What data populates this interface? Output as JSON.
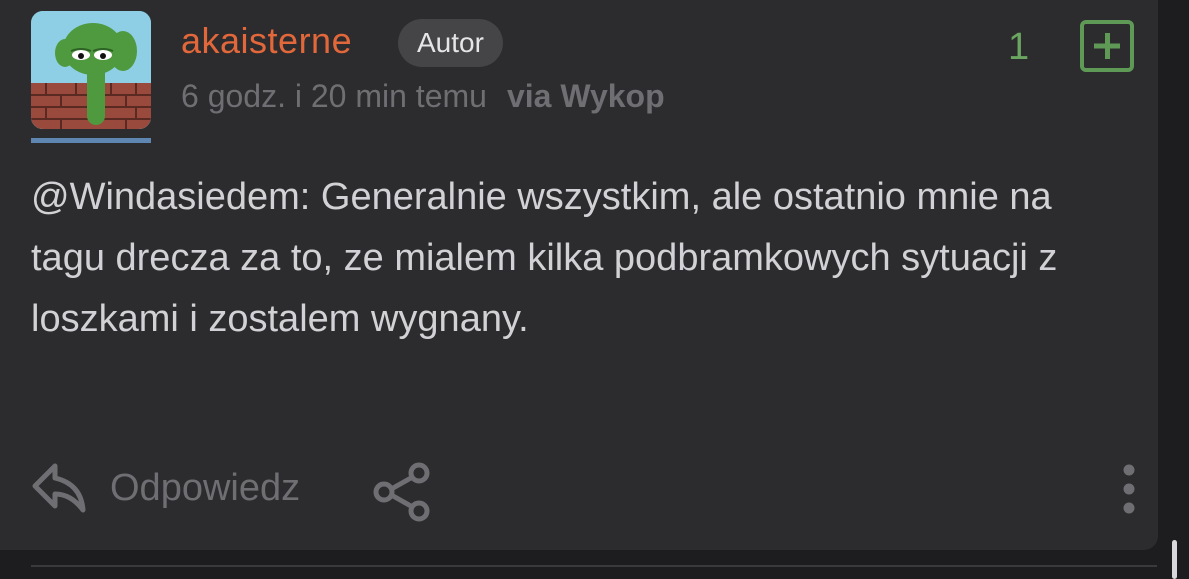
{
  "post": {
    "author": "akaisterne",
    "badge": "Autor",
    "time": "6 godz. i 20 min temu",
    "via": "via Wykop",
    "votes": "1",
    "text": "@Windasiedem: Generalnie wszystkim, ale ostatnio mnie na tagu drecza za to, ze mialem kilka podbramkowych sytuacji z loszkami i zostalem wygnany."
  },
  "actions": {
    "reply_label": "Odpowiedz"
  },
  "icons": {
    "reply": "reply-icon",
    "share": "share-icon",
    "more": "more-vertical-icon",
    "plus": "plus-square-icon",
    "avatar": "pepe-avatar"
  },
  "colors": {
    "background": "#2c2c2e",
    "username": "#e2673a",
    "vote": "#5e9a56",
    "muted": "#6f6f73",
    "text": "#d2d2d6"
  }
}
